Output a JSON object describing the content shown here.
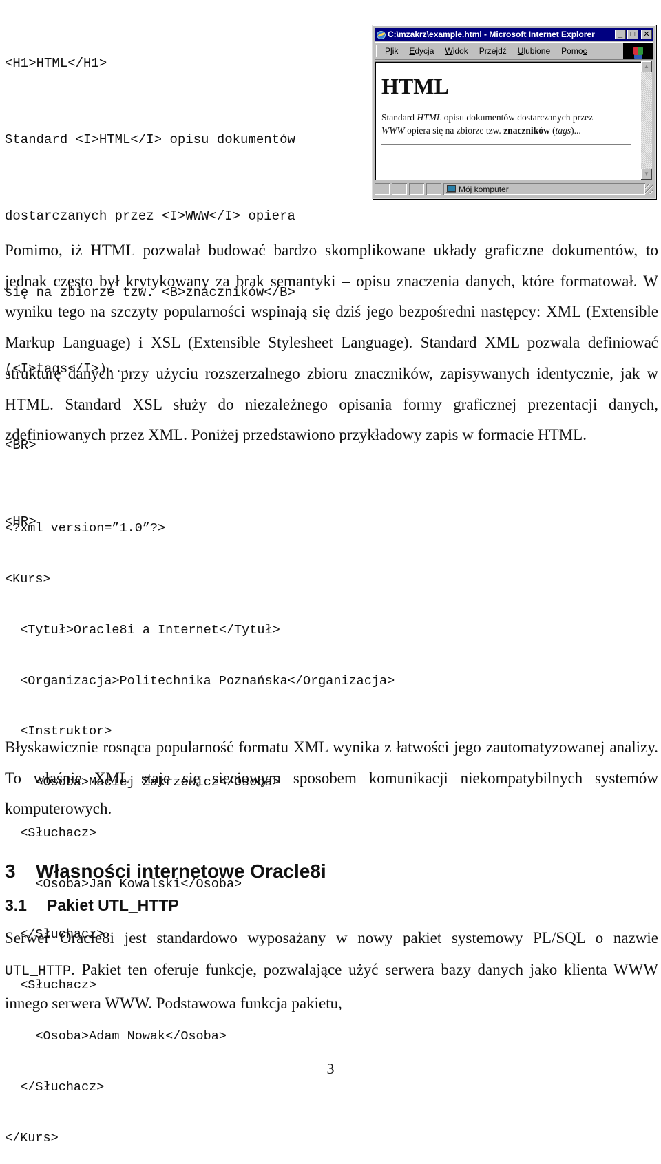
{
  "html_source_code": {
    "lines": [
      "<H1>HTML</H1>",
      "Standard <I>HTML</I> opisu dokumentów",
      "dostarczanych przez <I>WWW</I> opiera",
      "się na zbiorze tzw. <B>znaczników</B>",
      "(<I>tags</I>)...",
      "<BR>",
      "<HR>"
    ]
  },
  "browser_window": {
    "title": "C:\\mzakrz\\example.html - Microsoft Internet Explorer",
    "controls": {
      "minimize": "_",
      "maximize": "□",
      "close": "✕"
    },
    "menu": [
      {
        "label": "Plik",
        "access_key_index": 1
      },
      {
        "label": "Edycja",
        "access_key_index": 0
      },
      {
        "label": "Widok",
        "access_key_index": 0
      },
      {
        "label": "Przejdź",
        "access_key_index": 4
      },
      {
        "label": "Ulubione",
        "access_key_index": 0
      },
      {
        "label": "Pomoc",
        "access_key_index": 4
      }
    ],
    "content": {
      "heading": "HTML",
      "paragraph": {
        "line1_a": "Standard ",
        "line1_i": "HTML",
        "line1_b": " opisu dokumentów dostarczanych przez",
        "line2_i": "WWW",
        "line2_a": " opiera się na zbiorze tzw. ",
        "line2_bold": "znaczników",
        "line2_b": " (",
        "line2_i2": "tags",
        "line2_c": ")..."
      }
    },
    "status": {
      "zone_label": "Mój komputer",
      "zone_icon": "computer-icon"
    }
  },
  "paragraphs": {
    "p1": "Pomimo, iż HTML pozwalał budować bardzo skomplikowane układy graficzne dokumentów, to jednak często był krytykowany za brak semantyki – opisu znaczenia danych, które formatował. W wyniku tego na szczyty popularności wspinają się dziś jego bezpośredni następcy: XML (Extensible Markup Language) i XSL (Extensible Stylesheet Language). Standard XML pozwala definiować strukturę danych przy użyciu rozszerzalnego zbioru znaczników, zapisywanych identycznie, jak w HTML. Standard XSL służy do niezależnego opisania formy graficznej prezentacji danych, zdefiniowanych przez XML. Poniżej przedstawiono przykładowy zapis w formacie HTML.",
    "p3": "Błyskawicznie rosnąca popularność formatu XML wynika z łatwości jego zautomatyzowanej analizy. To właśnie XML staje się sieciowym sposobem komunikacji niekompatybilnych systemów komputerowych.",
    "p4_a": "Serwer Oracle8i jest standardowo wyposażany w nowy pakiet systemowy PL/SQL o nazwie ",
    "p4_code": "UTL_HTTP",
    "p4_b": ". Pakiet ten oferuje funkcje, pozwalające użyć serwera bazy danych jako klienta WWW innego serwera WWW. Podstawowa funkcja pakietu,"
  },
  "xml_example": {
    "lines": [
      "<?xml version=”1.0”?>",
      "<Kurs>",
      "  <Tytuł>Oracle8i a Internet</Tytuł>",
      "  <Organizacja>Politechnika Poznańska</Organizacja>",
      "  <Instruktor>",
      "    <Osoba>Maciej Zakrzewicz</Osoba>",
      "  <Słuchacz>",
      "    <Osoba>Jan Kowalski</Osoba>",
      "  </Słuchacz>",
      "  <Słuchacz>",
      "    <Osoba>Adam Nowak</Osoba>",
      "  </Słuchacz>",
      "</Kurs>"
    ]
  },
  "headings": {
    "section": {
      "number": "3",
      "title": "Własności internetowe Oracle8i"
    },
    "subsection": {
      "number": "3.1",
      "title": "Pakiet UTL_HTTP"
    }
  },
  "page_number": "3"
}
